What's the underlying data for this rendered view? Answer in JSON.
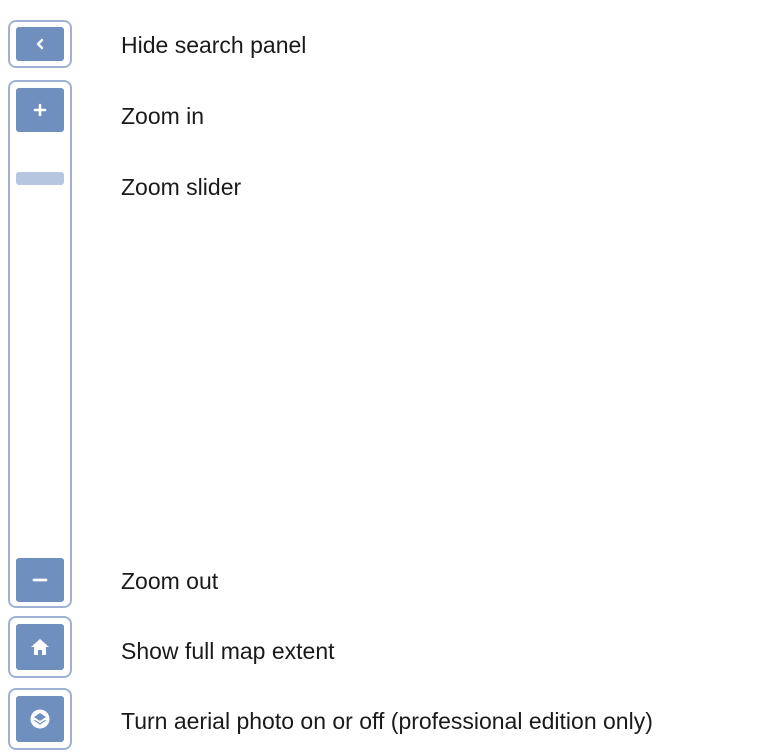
{
  "controls": {
    "hide_search_panel": {
      "label": "Hide search panel",
      "icon": "chevron-left-icon"
    },
    "zoom_in": {
      "label": "Zoom in",
      "icon": "plus-icon"
    },
    "zoom_slider": {
      "label": "Zoom slider"
    },
    "zoom_out": {
      "label": "Zoom out",
      "icon": "minus-icon"
    },
    "full_extent": {
      "label": "Show full map extent",
      "icon": "home-icon"
    },
    "aerial_photo": {
      "label": "Turn aerial photo on or off (professional edition only)",
      "icon": "layers-icon"
    }
  },
  "colors": {
    "button_fill": "#6f8fbf",
    "frame_border": "#9fb2d4",
    "slider_thumb": "#b7c6e0",
    "text": "#1a1a1a"
  }
}
